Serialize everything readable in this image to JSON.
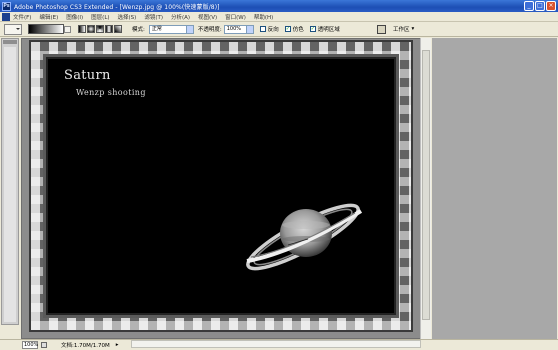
{
  "window": {
    "app_icon": "Ps",
    "title": "Adobe Photoshop CS3 Extended - [Wenzp.jpg @ 100%(快速蒙版/8)]",
    "controls": [
      "_",
      "□",
      "×"
    ]
  },
  "menu": [
    "文件(F)",
    "编辑(E)",
    "图像(I)",
    "图层(L)",
    "选择(S)",
    "滤镜(T)",
    "分析(A)",
    "视图(V)",
    "窗口(W)",
    "帮助(H)"
  ],
  "options": {
    "mode_label": "模式:",
    "mode_value": "正常",
    "opacity_label": "不透明度:",
    "opacity_value": "100%",
    "reverse_label": "反向",
    "dither_label": "仿色",
    "transparency_label": "透明区域",
    "workspace_label": "工作区",
    "workspace_arrow": "▾"
  },
  "canvas": {
    "title": "Saturn",
    "subtitle": "Wenzp shooting"
  },
  "status": {
    "zoom": "100%",
    "doc_info": "文档:1.70M/1.70M",
    "arrow": "▸"
  },
  "icons": {
    "app": "photoshop-icon",
    "minimize": "minimize-icon",
    "maximize": "maximize-icon",
    "close": "close-icon"
  }
}
